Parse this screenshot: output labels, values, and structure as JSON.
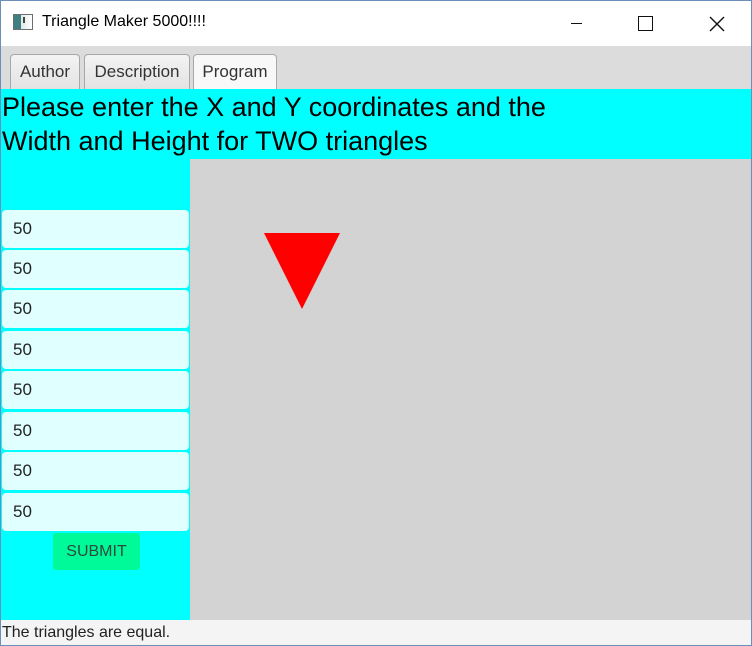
{
  "window": {
    "title": "Triangle Maker 5000!!!!",
    "controls": {
      "minimize": "minimize",
      "maximize": "maximize",
      "close": "close"
    }
  },
  "tabs": [
    {
      "label": "Author"
    },
    {
      "label": "Description"
    },
    {
      "label": "Program",
      "selected": true
    }
  ],
  "header": {
    "line1": "Please enter the X and Y coordinates and the",
    "line2": "Width and Height for TWO triangles"
  },
  "inputs": [
    {
      "value": "50"
    },
    {
      "value": "50"
    },
    {
      "value": "50"
    },
    {
      "value": "50"
    },
    {
      "value": "50"
    },
    {
      "value": "50"
    },
    {
      "value": "50"
    },
    {
      "value": "50"
    }
  ],
  "submit_label": "SUBMIT",
  "status_text": "The triangles are equal.",
  "colors": {
    "panel": "#00ffff",
    "field": "#e0ffff",
    "submit": "#00fa9a",
    "canvas": "#d3d3d3",
    "triangle": "#ff0000"
  }
}
